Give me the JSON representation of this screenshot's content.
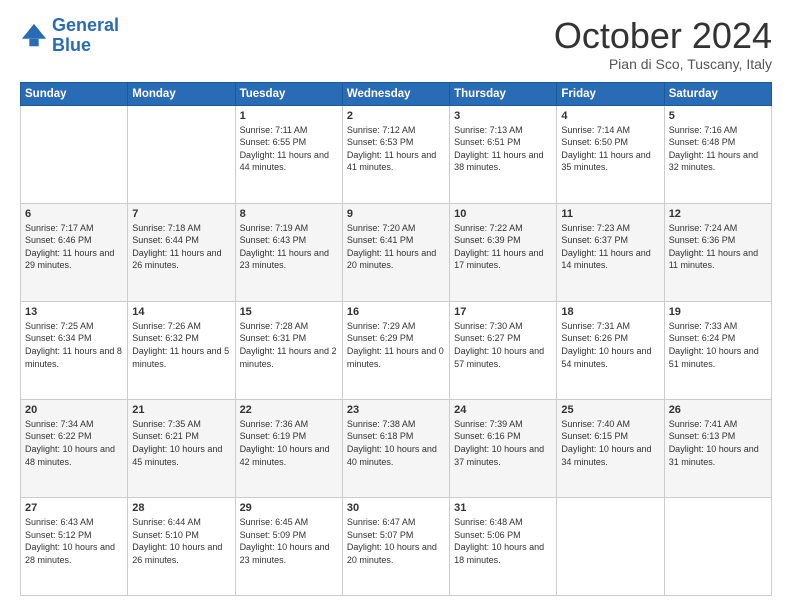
{
  "logo": {
    "line1": "General",
    "line2": "Blue"
  },
  "title": "October 2024",
  "location": "Pian di Sco, Tuscany, Italy",
  "weekdays": [
    "Sunday",
    "Monday",
    "Tuesday",
    "Wednesday",
    "Thursday",
    "Friday",
    "Saturday"
  ],
  "weeks": [
    [
      {
        "day": "",
        "sunrise": "",
        "sunset": "",
        "daylight": ""
      },
      {
        "day": "",
        "sunrise": "",
        "sunset": "",
        "daylight": ""
      },
      {
        "day": "1",
        "sunrise": "Sunrise: 7:11 AM",
        "sunset": "Sunset: 6:55 PM",
        "daylight": "Daylight: 11 hours and 44 minutes."
      },
      {
        "day": "2",
        "sunrise": "Sunrise: 7:12 AM",
        "sunset": "Sunset: 6:53 PM",
        "daylight": "Daylight: 11 hours and 41 minutes."
      },
      {
        "day": "3",
        "sunrise": "Sunrise: 7:13 AM",
        "sunset": "Sunset: 6:51 PM",
        "daylight": "Daylight: 11 hours and 38 minutes."
      },
      {
        "day": "4",
        "sunrise": "Sunrise: 7:14 AM",
        "sunset": "Sunset: 6:50 PM",
        "daylight": "Daylight: 11 hours and 35 minutes."
      },
      {
        "day": "5",
        "sunrise": "Sunrise: 7:16 AM",
        "sunset": "Sunset: 6:48 PM",
        "daylight": "Daylight: 11 hours and 32 minutes."
      }
    ],
    [
      {
        "day": "6",
        "sunrise": "Sunrise: 7:17 AM",
        "sunset": "Sunset: 6:46 PM",
        "daylight": "Daylight: 11 hours and 29 minutes."
      },
      {
        "day": "7",
        "sunrise": "Sunrise: 7:18 AM",
        "sunset": "Sunset: 6:44 PM",
        "daylight": "Daylight: 11 hours and 26 minutes."
      },
      {
        "day": "8",
        "sunrise": "Sunrise: 7:19 AM",
        "sunset": "Sunset: 6:43 PM",
        "daylight": "Daylight: 11 hours and 23 minutes."
      },
      {
        "day": "9",
        "sunrise": "Sunrise: 7:20 AM",
        "sunset": "Sunset: 6:41 PM",
        "daylight": "Daylight: 11 hours and 20 minutes."
      },
      {
        "day": "10",
        "sunrise": "Sunrise: 7:22 AM",
        "sunset": "Sunset: 6:39 PM",
        "daylight": "Daylight: 11 hours and 17 minutes."
      },
      {
        "day": "11",
        "sunrise": "Sunrise: 7:23 AM",
        "sunset": "Sunset: 6:37 PM",
        "daylight": "Daylight: 11 hours and 14 minutes."
      },
      {
        "day": "12",
        "sunrise": "Sunrise: 7:24 AM",
        "sunset": "Sunset: 6:36 PM",
        "daylight": "Daylight: 11 hours and 11 minutes."
      }
    ],
    [
      {
        "day": "13",
        "sunrise": "Sunrise: 7:25 AM",
        "sunset": "Sunset: 6:34 PM",
        "daylight": "Daylight: 11 hours and 8 minutes."
      },
      {
        "day": "14",
        "sunrise": "Sunrise: 7:26 AM",
        "sunset": "Sunset: 6:32 PM",
        "daylight": "Daylight: 11 hours and 5 minutes."
      },
      {
        "day": "15",
        "sunrise": "Sunrise: 7:28 AM",
        "sunset": "Sunset: 6:31 PM",
        "daylight": "Daylight: 11 hours and 2 minutes."
      },
      {
        "day": "16",
        "sunrise": "Sunrise: 7:29 AM",
        "sunset": "Sunset: 6:29 PM",
        "daylight": "Daylight: 11 hours and 0 minutes."
      },
      {
        "day": "17",
        "sunrise": "Sunrise: 7:30 AM",
        "sunset": "Sunset: 6:27 PM",
        "daylight": "Daylight: 10 hours and 57 minutes."
      },
      {
        "day": "18",
        "sunrise": "Sunrise: 7:31 AM",
        "sunset": "Sunset: 6:26 PM",
        "daylight": "Daylight: 10 hours and 54 minutes."
      },
      {
        "day": "19",
        "sunrise": "Sunrise: 7:33 AM",
        "sunset": "Sunset: 6:24 PM",
        "daylight": "Daylight: 10 hours and 51 minutes."
      }
    ],
    [
      {
        "day": "20",
        "sunrise": "Sunrise: 7:34 AM",
        "sunset": "Sunset: 6:22 PM",
        "daylight": "Daylight: 10 hours and 48 minutes."
      },
      {
        "day": "21",
        "sunrise": "Sunrise: 7:35 AM",
        "sunset": "Sunset: 6:21 PM",
        "daylight": "Daylight: 10 hours and 45 minutes."
      },
      {
        "day": "22",
        "sunrise": "Sunrise: 7:36 AM",
        "sunset": "Sunset: 6:19 PM",
        "daylight": "Daylight: 10 hours and 42 minutes."
      },
      {
        "day": "23",
        "sunrise": "Sunrise: 7:38 AM",
        "sunset": "Sunset: 6:18 PM",
        "daylight": "Daylight: 10 hours and 40 minutes."
      },
      {
        "day": "24",
        "sunrise": "Sunrise: 7:39 AM",
        "sunset": "Sunset: 6:16 PM",
        "daylight": "Daylight: 10 hours and 37 minutes."
      },
      {
        "day": "25",
        "sunrise": "Sunrise: 7:40 AM",
        "sunset": "Sunset: 6:15 PM",
        "daylight": "Daylight: 10 hours and 34 minutes."
      },
      {
        "day": "26",
        "sunrise": "Sunrise: 7:41 AM",
        "sunset": "Sunset: 6:13 PM",
        "daylight": "Daylight: 10 hours and 31 minutes."
      }
    ],
    [
      {
        "day": "27",
        "sunrise": "Sunrise: 6:43 AM",
        "sunset": "Sunset: 5:12 PM",
        "daylight": "Daylight: 10 hours and 28 minutes."
      },
      {
        "day": "28",
        "sunrise": "Sunrise: 6:44 AM",
        "sunset": "Sunset: 5:10 PM",
        "daylight": "Daylight: 10 hours and 26 minutes."
      },
      {
        "day": "29",
        "sunrise": "Sunrise: 6:45 AM",
        "sunset": "Sunset: 5:09 PM",
        "daylight": "Daylight: 10 hours and 23 minutes."
      },
      {
        "day": "30",
        "sunrise": "Sunrise: 6:47 AM",
        "sunset": "Sunset: 5:07 PM",
        "daylight": "Daylight: 10 hours and 20 minutes."
      },
      {
        "day": "31",
        "sunrise": "Sunrise: 6:48 AM",
        "sunset": "Sunset: 5:06 PM",
        "daylight": "Daylight: 10 hours and 18 minutes."
      },
      {
        "day": "",
        "sunrise": "",
        "sunset": "",
        "daylight": ""
      },
      {
        "day": "",
        "sunrise": "",
        "sunset": "",
        "daylight": ""
      }
    ]
  ]
}
